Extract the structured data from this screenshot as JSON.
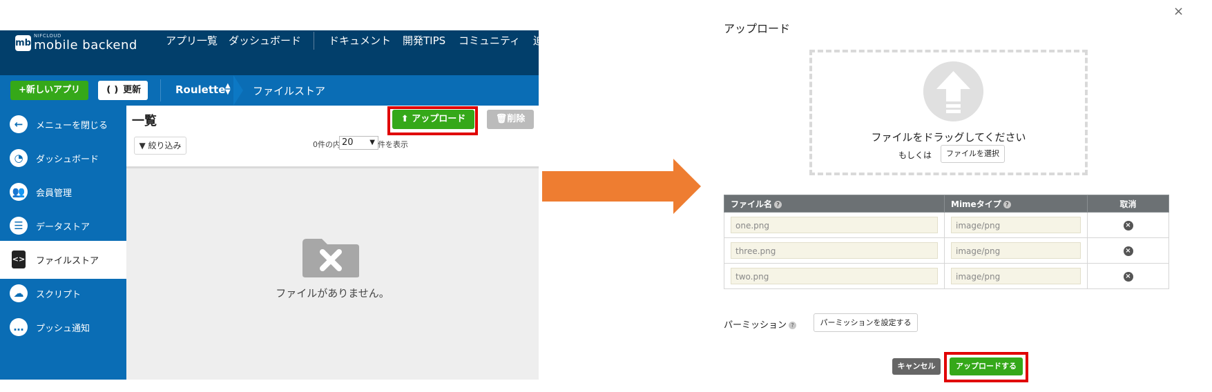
{
  "colors": {
    "nav_dark": "#023f6b",
    "nav_blue": "#0a6db5",
    "green": "#35a819",
    "highlight_red": "#e00000",
    "arrow_orange": "#ee7d31"
  },
  "app": {
    "logo": {
      "badge": "mb",
      "small": "NIFCLOUD",
      "text": "mobile backend"
    },
    "nav": [
      "アプリ一覧",
      "ダッシュボード",
      "ドキュメント",
      "開発TIPS",
      "コミュニティ",
      "迫"
    ],
    "new_app_label": "+新しいアプリ",
    "refresh_label": "更新",
    "app_name": "Roulette",
    "breadcrumb": "ファイルストア",
    "sidebar": [
      {
        "label": "メニューを閉じる",
        "icon": "arrow-left-icon",
        "glyph": "←"
      },
      {
        "label": "ダッシュボード",
        "icon": "dashboard-icon",
        "glyph": "◔"
      },
      {
        "label": "会員管理",
        "icon": "users-icon",
        "glyph": "👥"
      },
      {
        "label": "データストア",
        "icon": "database-icon",
        "glyph": "☰"
      },
      {
        "label": "ファイルストア",
        "icon": "file-code-icon",
        "glyph": "<>"
      },
      {
        "label": "スクリプト",
        "icon": "cloud-gear-icon",
        "glyph": "☁"
      },
      {
        "label": "プッシュ通知",
        "icon": "chat-icon",
        "glyph": "…"
      }
    ],
    "active_sidebar_index": 4,
    "content": {
      "title": "一覧",
      "upload_label": "アップロード",
      "delete_label": "削除",
      "filter_label": "絞り込み",
      "count_prefix": "0件の内",
      "count_value": "20",
      "count_suffix": "件を表示",
      "empty_message": "ファイルがありません。"
    }
  },
  "dialog": {
    "title": "アップロード",
    "close_glyph": "×",
    "drop_text": "ファイルをドラッグしてください",
    "or_text": "もしくは",
    "choose_label": "ファイルを選択",
    "columns": {
      "filename": "ファイル名",
      "mime": "Mimeタイプ",
      "cancel": "取消"
    },
    "help_glyph": "?",
    "files": [
      {
        "name": "one.png",
        "mime": "image/png"
      },
      {
        "name": "three.png",
        "mime": "image/png"
      },
      {
        "name": "two.png",
        "mime": "image/png"
      }
    ],
    "permission_label": "パーミッション",
    "permission_button": "パーミッションを設定する",
    "cancel_button": "キャンセル",
    "upload_button": "アップロードする"
  }
}
